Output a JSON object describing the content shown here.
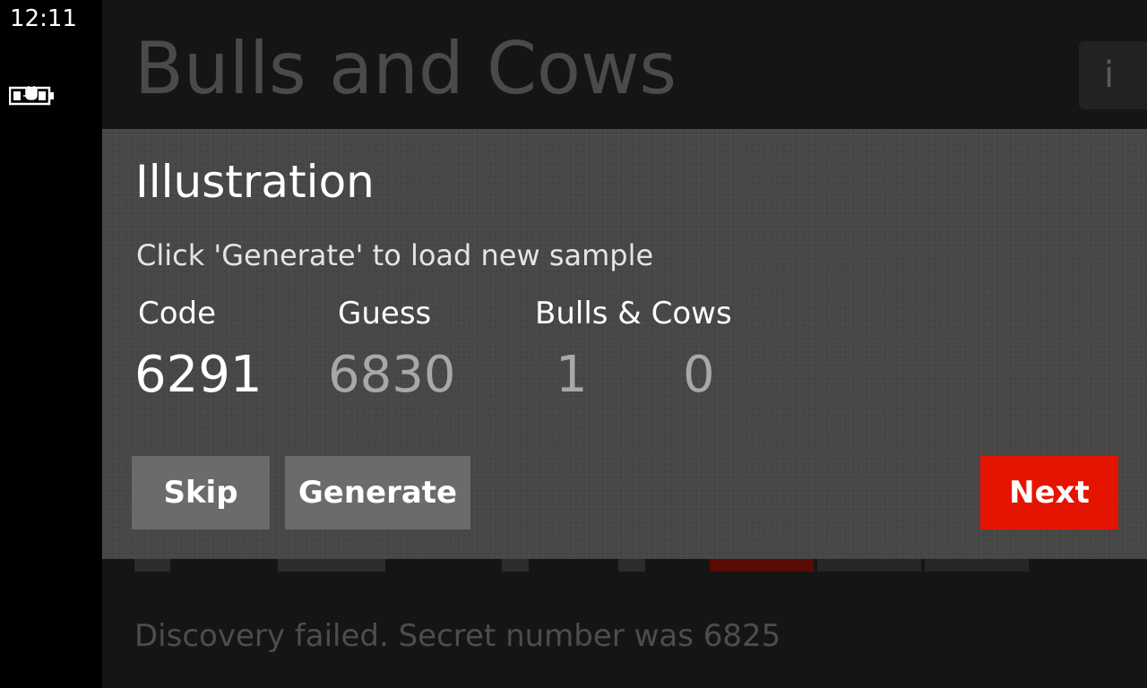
{
  "status": {
    "time": "12:11",
    "battery_icon": "battery-charging-icon"
  },
  "app": {
    "title": "Bulls and Cows",
    "info_label": "i",
    "status_message": "Discovery failed. Secret number was 6825"
  },
  "dialog": {
    "title": "Illustration",
    "instruction": "Click 'Generate' to load new sample",
    "columns": {
      "code": "Code",
      "guess": "Guess",
      "bulls_cows": "Bulls & Cows"
    },
    "values": {
      "code": "6291",
      "guess": "6830",
      "bulls": "1",
      "cows": "0"
    },
    "buttons": {
      "skip": "Skip",
      "generate": "Generate",
      "next": "Next"
    }
  },
  "colors": {
    "accent": "#e51400",
    "dialog_bg": "#474747",
    "button_bg": "#6b6b6b"
  }
}
